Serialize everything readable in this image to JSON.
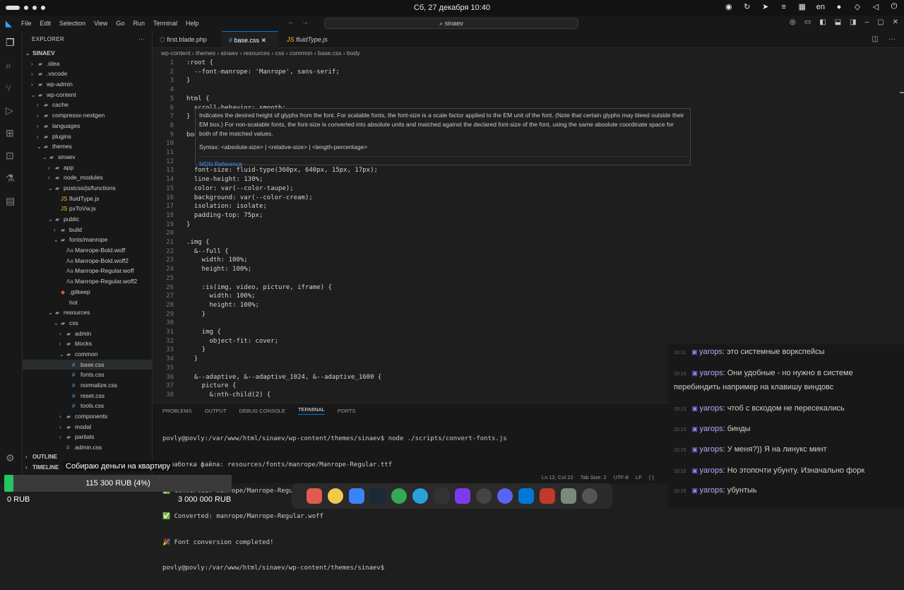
{
  "system_bar": {
    "clock": "Сб, 27 декабря 10:40",
    "lang": "en"
  },
  "vscode": {
    "menu": [
      "File",
      "Edit",
      "Selection",
      "View",
      "Go",
      "Run",
      "Terminal",
      "Help"
    ],
    "command_center": "sinaev"
  },
  "explorer": {
    "title": "EXPLORER",
    "root": "SINAEV",
    "items": [
      {
        "label": ".idea",
        "depth": 1,
        "type": "folder",
        "open": false
      },
      {
        "label": ".vscode",
        "depth": 1,
        "type": "folder",
        "open": false
      },
      {
        "label": "wp-admin",
        "depth": 1,
        "type": "folder",
        "open": false
      },
      {
        "label": "wp-content",
        "depth": 1,
        "type": "folder",
        "open": true
      },
      {
        "label": "cache",
        "depth": 2,
        "type": "folder",
        "open": false
      },
      {
        "label": "compressx-nextgen",
        "depth": 2,
        "type": "folder",
        "open": false
      },
      {
        "label": "languages",
        "depth": 2,
        "type": "folder",
        "open": false
      },
      {
        "label": "plugins",
        "depth": 2,
        "type": "folder",
        "open": false
      },
      {
        "label": "themes",
        "depth": 2,
        "type": "folder",
        "open": true
      },
      {
        "label": "sinaev",
        "depth": 3,
        "type": "folder",
        "open": true
      },
      {
        "label": "app",
        "depth": 4,
        "type": "folder",
        "open": false
      },
      {
        "label": "node_modules",
        "depth": 4,
        "type": "folder",
        "open": false
      },
      {
        "label": "postcss/js/functions",
        "depth": 4,
        "type": "folder",
        "open": true
      },
      {
        "label": "fluidType.js",
        "depth": 5,
        "type": "js"
      },
      {
        "label": "pxToVw.js",
        "depth": 5,
        "type": "js"
      },
      {
        "label": "public",
        "depth": 4,
        "type": "folder",
        "open": true
      },
      {
        "label": "build",
        "depth": 5,
        "type": "folder",
        "open": false
      },
      {
        "label": "fonts/manrope",
        "depth": 5,
        "type": "folder",
        "open": true
      },
      {
        "label": "Manrope-Bold.woff",
        "depth": 6,
        "type": "font"
      },
      {
        "label": "Manrope-Bold.woff2",
        "depth": 6,
        "type": "font"
      },
      {
        "label": "Manrope-Regular.woff",
        "depth": 6,
        "type": "font"
      },
      {
        "label": "Manrope-Regular.woff2",
        "depth": 6,
        "type": "font"
      },
      {
        "label": ".gitkeep",
        "depth": 5,
        "type": "git"
      },
      {
        "label": "hot",
        "depth": 5,
        "type": "file"
      },
      {
        "label": "resources",
        "depth": 4,
        "type": "folder",
        "open": true
      },
      {
        "label": "css",
        "depth": 5,
        "type": "folder",
        "open": true
      },
      {
        "label": "admin",
        "depth": 6,
        "type": "folder",
        "open": false
      },
      {
        "label": "blocks",
        "depth": 6,
        "type": "folder",
        "open": false
      },
      {
        "label": "common",
        "depth": 6,
        "type": "folder",
        "open": true
      },
      {
        "label": "base.css",
        "depth": 7,
        "type": "css",
        "selected": true
      },
      {
        "label": "fonts.css",
        "depth": 7,
        "type": "css"
      },
      {
        "label": "normalize.css",
        "depth": 7,
        "type": "css"
      },
      {
        "label": "reset.css",
        "depth": 7,
        "type": "css"
      },
      {
        "label": "tools.css",
        "depth": 7,
        "type": "css"
      },
      {
        "label": "components",
        "depth": 6,
        "type": "folder",
        "open": false
      },
      {
        "label": "modal",
        "depth": 6,
        "type": "folder",
        "open": false
      },
      {
        "label": "partials",
        "depth": 6,
        "type": "folder",
        "open": false
      },
      {
        "label": "admin.css",
        "depth": 6,
        "type": "css"
      }
    ],
    "outline": "OUTLINE",
    "timeline": "TIMELINE"
  },
  "tabs": [
    {
      "label": "first.blade.php",
      "active": false
    },
    {
      "label": "base.css",
      "active": true
    },
    {
      "label": "fluidType.js",
      "active": false
    }
  ],
  "breadcrumbs": "wp-content › themes › sinaev › resources › css › common › base.css › body",
  "code_lines": [
    {
      "n": "1",
      "html": ":root {"
    },
    {
      "n": "2",
      "html": "  --font-manrope: 'Manrope', sans-serif;"
    },
    {
      "n": "3",
      "html": "}"
    },
    {
      "n": "4",
      "html": ""
    },
    {
      "n": "5",
      "html": "html {"
    },
    {
      "n": "6",
      "html": "  scroll-behavior: smooth;"
    },
    {
      "n": "7",
      "html": "}"
    },
    {
      "n": "8",
      "html": ""
    },
    {
      "n": "9",
      "html": "body {"
    },
    {
      "n": "10",
      "html": ""
    },
    {
      "n": "11",
      "html": ""
    },
    {
      "n": "12",
      "html": ""
    },
    {
      "n": "13",
      "html": "  font-size: fluid-type(360px, 640px, 15px, 17px);"
    },
    {
      "n": "14",
      "html": "  line-height: 130%;"
    },
    {
      "n": "15",
      "html": "  color: var(--color-taupe);"
    },
    {
      "n": "16",
      "html": "  background: var(--color-cream);"
    },
    {
      "n": "17",
      "html": "  isolation: isolate;"
    },
    {
      "n": "18",
      "html": "  padding-top: 75px;"
    },
    {
      "n": "19",
      "html": "}"
    },
    {
      "n": "20",
      "html": ""
    },
    {
      "n": "21",
      "html": ".img {"
    },
    {
      "n": "22",
      "html": "  &--full {"
    },
    {
      "n": "23",
      "html": "    width: 100%;"
    },
    {
      "n": "24",
      "html": "    height: 100%;"
    },
    {
      "n": "25",
      "html": ""
    },
    {
      "n": "26",
      "html": "    :is(img, video, picture, iframe) {"
    },
    {
      "n": "27",
      "html": "      width: 100%;"
    },
    {
      "n": "28",
      "html": "      height: 100%;"
    },
    {
      "n": "29",
      "html": "    }"
    },
    {
      "n": "30",
      "html": ""
    },
    {
      "n": "31",
      "html": "    img {"
    },
    {
      "n": "32",
      "html": "      object-fit: cover;"
    },
    {
      "n": "33",
      "html": "    }"
    },
    {
      "n": "34",
      "html": "  }"
    },
    {
      "n": "35",
      "html": ""
    },
    {
      "n": "36",
      "html": "  &--adaptive, &--adaptive_1024, &--adaptive_1600 {"
    },
    {
      "n": "37",
      "html": "    picture {"
    },
    {
      "n": "38",
      "html": "      &:nth-child(2) {"
    }
  ],
  "hover": {
    "text": "Indicates the desired height of glyphs from the font. For scalable fonts, the font-size is a scale factor applied to the EM unit of the font. (Note that certain glyphs may bleed outside their EM box.) For non-scalable fonts, the font-size is converted into absolute units and matched against the declared font-size of the font, using the same absolute coordinate space for both of the matched values.",
    "syntax": "Syntax: <absolute-size> | <relative-size> | <length-percentage>",
    "link": "MDN Reference"
  },
  "panel": {
    "tabs": [
      "PROBLEMS",
      "OUTPUT",
      "DEBUG CONSOLE",
      "TERMINAL",
      "PORTS"
    ],
    "active": "TERMINAL",
    "lines": [
      "povly@povly:/var/www/html/sinaev/wp-content/themes/sinaev$ node ./scripts/convert-fonts.js",
      "Обработка файла: resources/fonts/manrope/Manrope-Regular.ttf",
      "✅ Converted: manrope/Manrope-Regular.woff2",
      "✅ Converted: manrope/Manrope-Regular.woff",
      "🎉 Font conversion completed!",
      "povly@povly:/var/www/html/sinaev/wp-content/themes/sinaev$ "
    ]
  },
  "status_bar": [
    "Ln 12, Col 22",
    "Tab Size: 2",
    "UTF-8",
    "LF",
    "{ }"
  ],
  "chat": [
    {
      "time": "10:11",
      "user": "yarops",
      "text": "это системные воркспейсы"
    },
    {
      "time": "10:13",
      "user": "yarops",
      "text": "Они удобные - но нужно в системе перебиндить например на клавишу виндовс"
    },
    {
      "time": "10:13",
      "user": "yarops",
      "text": "чтоб с вскодом не пересекались"
    },
    {
      "time": "10:13",
      "user": "yarops",
      "text": "бинды"
    },
    {
      "time": "10:15",
      "user": "yarops",
      "text": "У меня?)) Я на линукс минт"
    },
    {
      "time": "10:15",
      "user": "yarops",
      "text": "Но этопочти убунту. Изначально форк"
    },
    {
      "time": "10:15",
      "user": "yarops",
      "text": "убунтыь"
    }
  ],
  "donation": {
    "title": "Собираю деньги на квартиру",
    "progress_label": "115 300 RUB (4%)",
    "progress": 0.04,
    "min": "0 RUB",
    "max": "3 000 000 RUB"
  },
  "colors": {
    "accent": "#0078d4",
    "progress": "#22c55e"
  }
}
